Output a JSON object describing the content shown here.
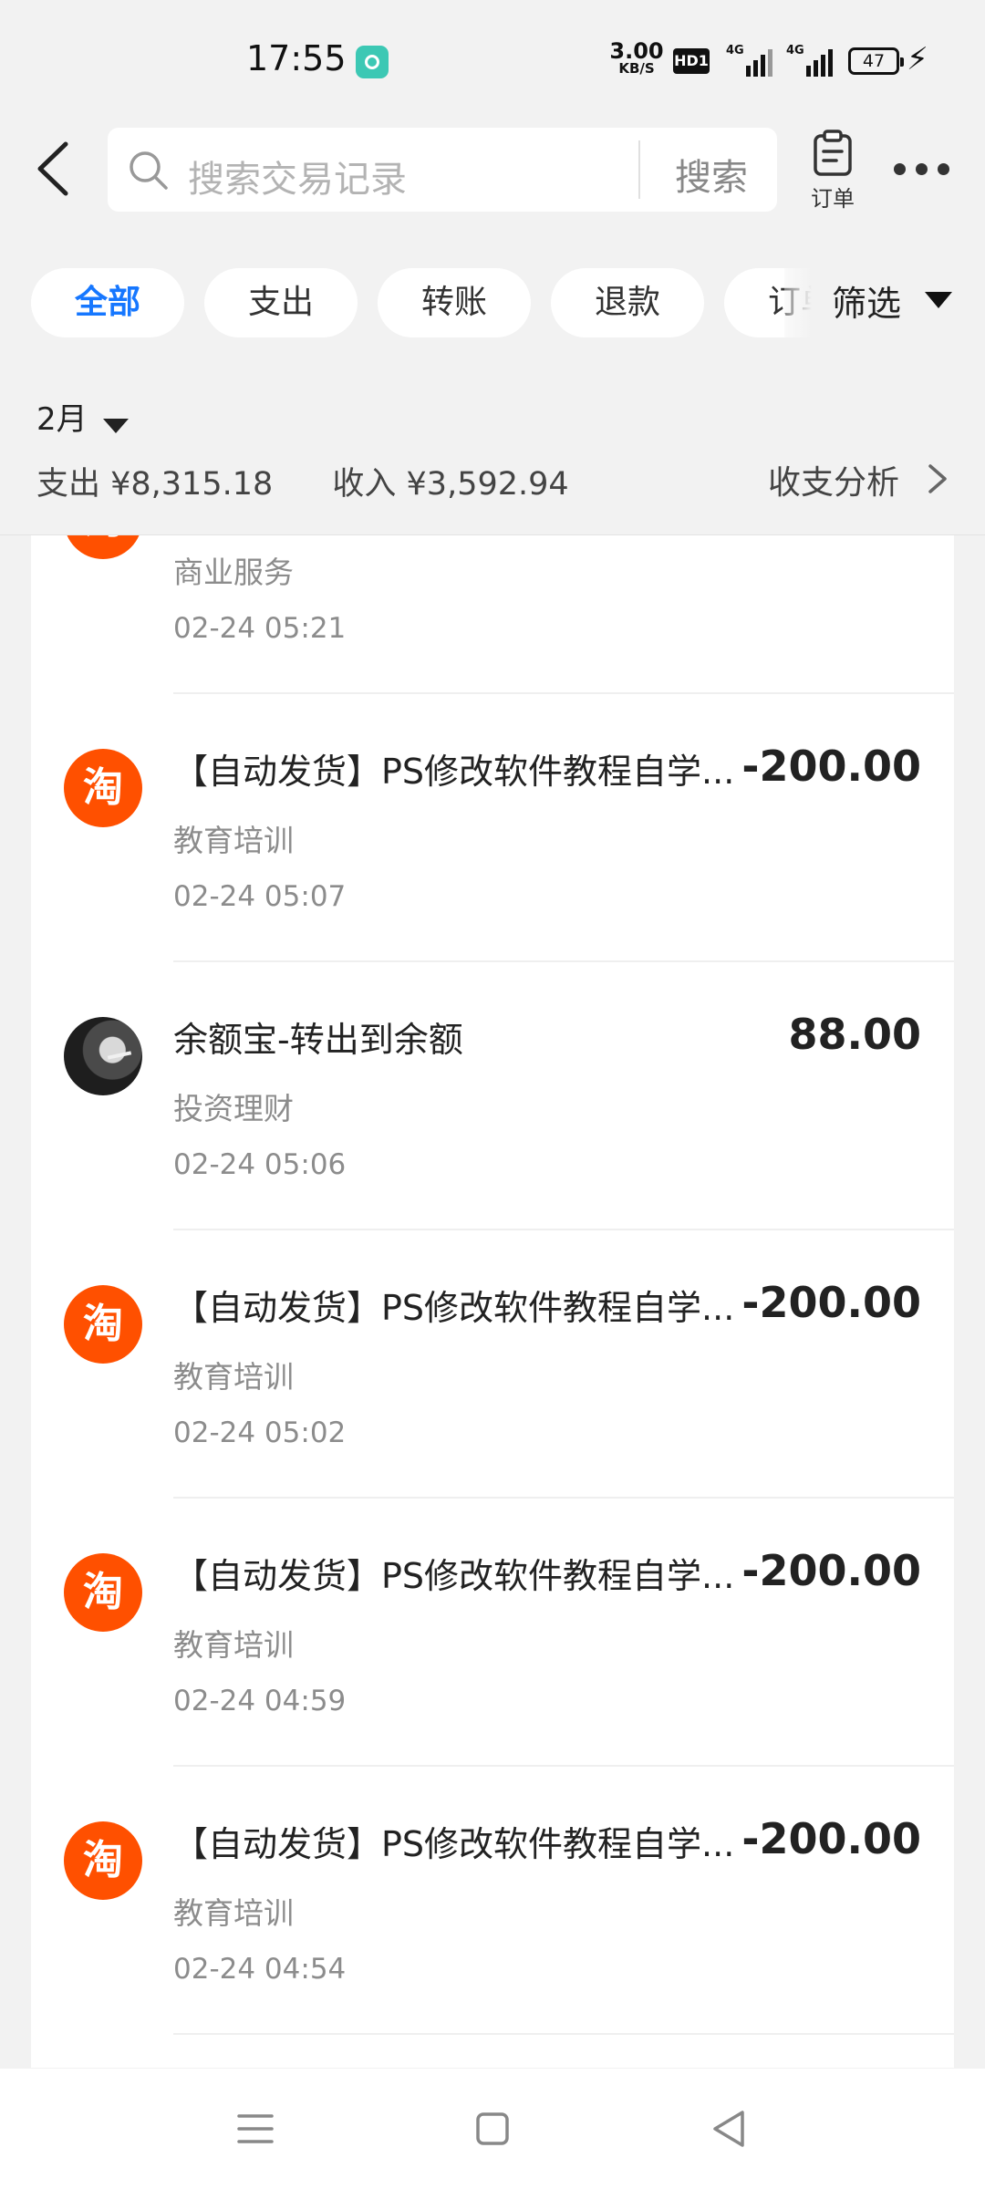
{
  "status_bar": {
    "time": "17:55",
    "net_speed": "3.00",
    "net_unit": "KB/S",
    "hd": "HD1",
    "signal_1": "4G",
    "signal_2": "4G",
    "battery": "47"
  },
  "header": {
    "search_placeholder": "搜索交易记录",
    "search_button": "搜索",
    "order_label": "订单",
    "back_icon": "chevron-left-icon",
    "order_icon": "clipboard-icon",
    "more_icon": "more-dots-icon"
  },
  "filters": {
    "chips": [
      "全部",
      "支出",
      "转账",
      "退款",
      "订单"
    ],
    "active_index": 0,
    "filter_label": "筛选",
    "active_color": "#1677ff"
  },
  "month": {
    "label": "2月",
    "expense": "支出 ¥8,315.18",
    "income": "收入 ¥3,592.94",
    "analysis": "收支分析"
  },
  "transactions": [
    {
      "avatar": "淘",
      "avatar_type": "taobao",
      "title": "",
      "amount": "",
      "category": "商业服务",
      "time": "02-24 05:21"
    },
    {
      "avatar": "淘",
      "avatar_type": "taobao",
      "title": "【自动发货】PS修改软件教程自学...",
      "amount": "-200.00",
      "category": "教育培训",
      "time": "02-24 05:07"
    },
    {
      "avatar": "",
      "avatar_type": "photo",
      "title": "余额宝-转出到余额",
      "amount": "88.00",
      "category": "投资理财",
      "time": "02-24 05:06"
    },
    {
      "avatar": "淘",
      "avatar_type": "taobao",
      "title": "【自动发货】PS修改软件教程自学...",
      "amount": "-200.00",
      "category": "教育培训",
      "time": "02-24 05:02"
    },
    {
      "avatar": "淘",
      "avatar_type": "taobao",
      "title": "【自动发货】PS修改软件教程自学...",
      "amount": "-200.00",
      "category": "教育培训",
      "time": "02-24 04:59"
    },
    {
      "avatar": "淘",
      "avatar_type": "taobao",
      "title": "【自动发货】PS修改软件教程自学...",
      "amount": "-200.00",
      "category": "教育培训",
      "time": "02-24 04:54"
    }
  ],
  "navbar": {
    "icons": [
      "menu-icon",
      "home-square-icon",
      "back-triangle-icon"
    ]
  },
  "colors": {
    "taobao_orange": "#ff5000",
    "background": "#f2f2f2"
  }
}
